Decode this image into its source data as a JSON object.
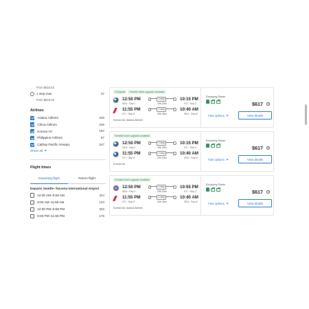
{
  "sidebar": {
    "stops_from_price_top": "From $616.53",
    "stops_option": {
      "label": "1 stop max",
      "count": "37",
      "from_price": "From $616.53"
    },
    "airlines_title": "Airlines",
    "airlines": [
      {
        "label": "Asiana Airlines",
        "count": "226"
      },
      {
        "label": "China Airlines",
        "count": "249"
      },
      {
        "label": "Korean Air",
        "count": "192"
      },
      {
        "label": "Philippine Airlines",
        "count": "67"
      },
      {
        "label": "Cathay Pacific Airways",
        "count": "347"
      }
    ],
    "show_all": "Show all",
    "flight_times_title": "Flight times",
    "tabs": {
      "departing": "Departing flight",
      "return": "Return flight"
    },
    "departs_label": "Departs Seattle–Tacoma International Airport",
    "time_ranges": [
      {
        "label": "12:00 AM–5:59 AM",
        "count": "324"
      },
      {
        "label": "6:00 AM–11:59 AM",
        "count": "134"
      },
      {
        "label": "12:00 PM–5:59 PM",
        "count": "333"
      },
      {
        "label": "6:00 PM–11:59 PM",
        "count": "175"
      }
    ]
  },
  "results": [
    {
      "badges": [
        "Cheapest",
        "Flexible ticket upgrade available"
      ],
      "legs": [
        {
          "logo": "asiana-logo",
          "dep_time": "12:50 PM",
          "dep_meta": "SEA · Sep 1",
          "stops": "1 stop",
          "duration": "19h 25m",
          "arr_time": "10:15 PM",
          "arr_meta": "KTI · Sep 2"
        },
        {
          "logo": "china-logo",
          "dep_time": "11:55 PM",
          "dep_meta": "KTI · Sep 8",
          "stops": "1 stop",
          "duration": "24h 45m",
          "arr_time": "10:40 AM",
          "arr_meta": "SEA · Sep 8"
        }
      ],
      "airline_name": "Korean Air, Asiana Airlines",
      "fare_class": "Economy Saver",
      "price": "$617",
      "fare_options": "Fare options",
      "view_details": "View details"
    },
    {
      "badges": [
        "Flexible ticket upgrade available"
      ],
      "legs": [
        {
          "logo": "asiana-logo",
          "dep_time": "12:50 PM",
          "dep_meta": "SEA · Sep 1",
          "stops": "1 stop",
          "duration": "19h 25m",
          "arr_time": "10:15 PM",
          "arr_meta": "KTI · Sep 2"
        },
        {
          "logo": "asiana-logo",
          "dep_time": "11:55 PM",
          "dep_meta": "KTI · Sep 8",
          "stops": "1 stop",
          "duration": "23h 25m",
          "arr_time": "10:40 AM",
          "arr_meta": "SEA · Sep 8"
        }
      ],
      "airline_name": "Korean Air",
      "fare_class": "Economy Saver",
      "price": "$617",
      "fare_options": "Fare options",
      "view_details": "View details"
    },
    {
      "badges": [
        "Flexible ticket upgrade available"
      ],
      "legs": [
        {
          "logo": "korean-logo",
          "dep_time": "12:50 PM",
          "dep_meta": "SEA · Sep 1",
          "stops": "1 stop",
          "duration": "20h 05m",
          "arr_time": "10:55 PM",
          "arr_meta": "KTI · Sep 2"
        },
        {
          "logo": "china-logo",
          "dep_time": "11:55 PM",
          "dep_meta": "KTI · Sep 8",
          "stops": "1 stop",
          "duration": "24h 45m",
          "arr_time": "10:40 AM",
          "arr_meta": "SEA · Sep 8"
        }
      ],
      "airline_name": "Korean Air, Asiana Airlines",
      "fare_class": "Economy Saver",
      "price": "$617",
      "fare_options": "Fare options",
      "view_details": "View details"
    }
  ],
  "colors": {
    "accent": "#1f6fc6",
    "badge_green": "#1a7f37",
    "bag_green": "#2e8b57"
  }
}
